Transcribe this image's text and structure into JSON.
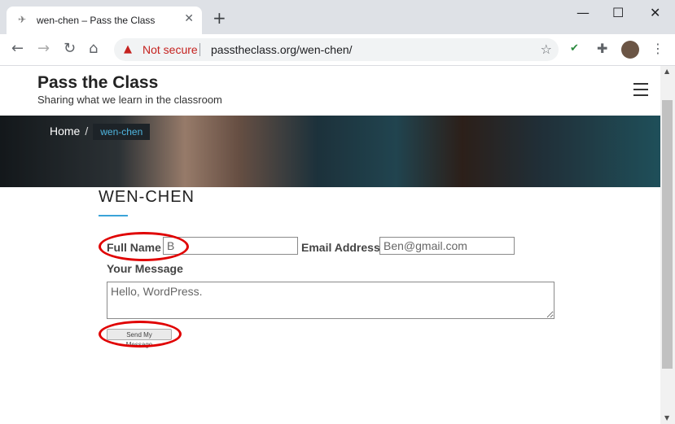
{
  "browser": {
    "tab_title": "wen-chen – Pass the Class",
    "new_tab_icon": "+",
    "security_label": "Not secure",
    "url": "passtheclass.org/wen-chen/",
    "window_controls": [
      "minimize",
      "maximize",
      "close"
    ]
  },
  "site": {
    "brand": "Pass the Class",
    "tagline": "Sharing what we learn in the classroom",
    "breadcrumb": {
      "home": "Home",
      "separator": "/",
      "current": "wen-chen"
    },
    "page_title": "WEN-CHEN"
  },
  "form": {
    "full_name_label": "Full Name",
    "full_name_value": "B",
    "email_label": "Email Address",
    "email_value": "Ben@gmail.com",
    "message_label": "Your Message",
    "message_value": "Hello, WordPress.",
    "send_label": "Send My Message"
  },
  "colors": {
    "accent": "#3ba4d8",
    "annotation": "#e00000",
    "not_secure": "#c5221f"
  }
}
